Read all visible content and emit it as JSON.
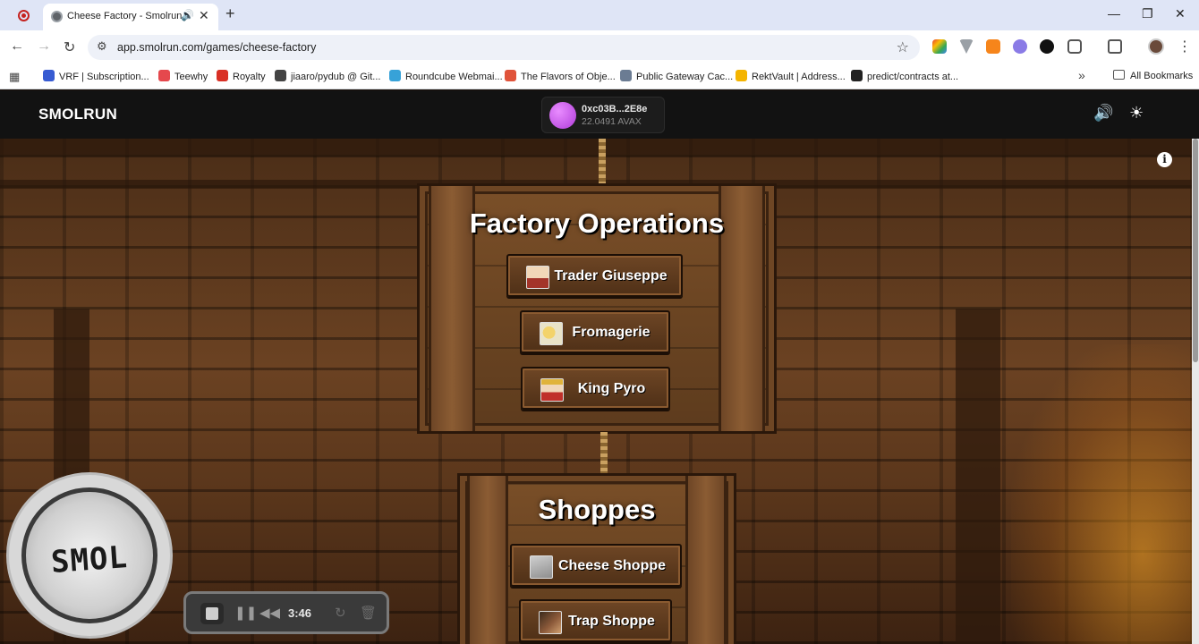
{
  "browser": {
    "tab_title": "Cheese Factory - Smolrun",
    "url": "app.smolrun.com/games/cheese-factory",
    "bookmarks": [
      {
        "label": "VRF | Subscription...",
        "color": "#375bd2"
      },
      {
        "label": "Teewhy",
        "color": "#e5484d"
      },
      {
        "label": "Royalty",
        "color": "#d93025"
      },
      {
        "label": "jiaaro/pydub @ Git...",
        "color": "#444444"
      },
      {
        "label": "Roundcube Webmai...",
        "color": "#37a2d8"
      },
      {
        "label": "The Flavors of Obje...",
        "color": "#e0533a"
      },
      {
        "label": "Public Gateway Cac...",
        "color": "#6b7c93"
      },
      {
        "label": "RektVault | Address...",
        "color": "#f4b400"
      },
      {
        "label": "predict/contracts at...",
        "color": "#222222"
      }
    ],
    "all_bookmarks": "All Bookmarks"
  },
  "app": {
    "logo": "SMOLRUN",
    "wallet": {
      "address": "0xc03B...2E8e",
      "balance": "22.0491 AVAX"
    }
  },
  "factory": {
    "title": "Factory Operations",
    "buttons": [
      {
        "label": "Trader Giuseppe",
        "icon": "trader-giuseppe-icon"
      },
      {
        "label": "Fromagerie",
        "icon": "fromagerie-icon"
      },
      {
        "label": "King Pyro",
        "icon": "king-pyro-icon"
      }
    ]
  },
  "shoppes": {
    "title": "Shoppes",
    "buttons": [
      {
        "label": "Cheese Shoppe",
        "icon": "cheese-shoppe-icon"
      },
      {
        "label": "Trap Shoppe",
        "icon": "trap-shoppe-icon"
      }
    ]
  },
  "recorder": {
    "webcam_text": "SMOL",
    "time": "3:46"
  }
}
